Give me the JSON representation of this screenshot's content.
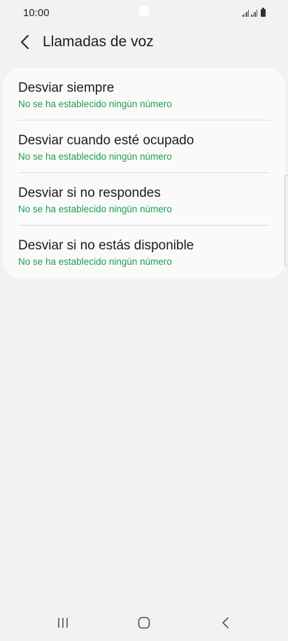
{
  "status_bar": {
    "time": "10:00"
  },
  "header": {
    "title": "Llamadas de voz",
    "back_icon": "chevron-left-icon"
  },
  "menu": {
    "items": [
      {
        "title": "Desviar siempre",
        "subtitle": "No se ha establecido ningún número"
      },
      {
        "title": "Desviar cuando esté ocupado",
        "subtitle": "No se ha establecido ningún número"
      },
      {
        "title": "Desviar si no respondes",
        "subtitle": "No se ha establecido ningún número"
      },
      {
        "title": "Desviar si no estás disponible",
        "subtitle": "No se ha establecido ningún número"
      }
    ]
  },
  "colors": {
    "background": "#f2f2f2",
    "card": "#fafafa",
    "accent_green": "#1e9d55",
    "text": "#1c1c1c"
  },
  "navigation": {
    "recent_icon": "recent-apps-icon",
    "home_icon": "home-icon",
    "back_icon": "back-icon"
  }
}
